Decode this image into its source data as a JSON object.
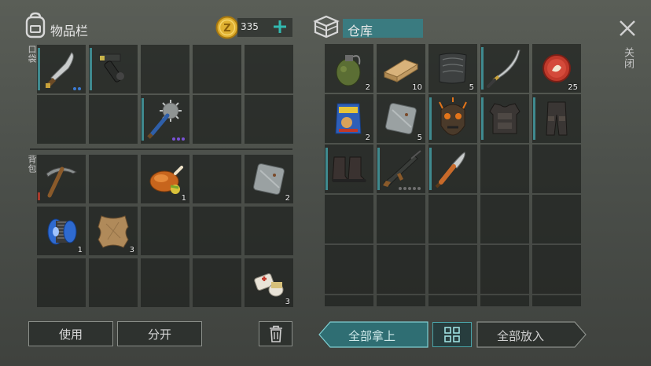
{
  "inventory": {
    "title": "物品栏",
    "coins": "335",
    "pocket_label": "口袋",
    "backpack_label": "背包",
    "use_button": "使用",
    "split_button": "分开",
    "items": [
      {
        "name": "machete-item",
        "icon": "machete-icon",
        "slot": [
          0,
          0
        ],
        "bar": "teal",
        "dots": [
          "#3b7bd4",
          "#3b7bd4"
        ]
      },
      {
        "name": "pistol-item",
        "icon": "pistol-icon",
        "slot": [
          1,
          0
        ],
        "bar": "teal"
      },
      {
        "name": "spiked-mace-item",
        "icon": "spiked-mace-icon",
        "slot": [
          2,
          1
        ],
        "bar": "teal",
        "dots": [
          "#7a52d6",
          "#7a52d6",
          "#7a52d6"
        ]
      },
      {
        "name": "pickaxe-item",
        "icon": "pickaxe-icon",
        "slot": [
          0,
          2
        ],
        "bar": "red"
      },
      {
        "name": "roast-chicken-item",
        "icon": "roast-chicken-icon",
        "slot": [
          2,
          2
        ],
        "count": "1"
      },
      {
        "name": "metal-plate-item",
        "icon": "metal-plate-icon",
        "slot": [
          4,
          2
        ],
        "count": "2"
      },
      {
        "name": "wire-spool-item",
        "icon": "wire-spool-icon",
        "slot": [
          0,
          3
        ],
        "count": "1"
      },
      {
        "name": "leather-item",
        "icon": "leather-icon",
        "slot": [
          1,
          3
        ],
        "count": "3"
      },
      {
        "name": "bandage-item",
        "icon": "bandage-icon",
        "slot": [
          4,
          4
        ],
        "count": "3"
      }
    ]
  },
  "storage": {
    "title": "仓库",
    "take_all_button": "全部拿上",
    "put_all_button": "全部放入",
    "items": [
      {
        "name": "grenade-item",
        "icon": "grenade-icon",
        "slot": [
          0,
          0
        ],
        "count": "2"
      },
      {
        "name": "wood-plank-item",
        "icon": "wood-plank-icon",
        "slot": [
          1,
          0
        ],
        "count": "10"
      },
      {
        "name": "tarp-item",
        "icon": "tarp-icon",
        "slot": [
          2,
          0
        ],
        "count": "5"
      },
      {
        "name": "katana-item",
        "icon": "katana-icon",
        "slot": [
          3,
          0
        ],
        "bar": "teal"
      },
      {
        "name": "bottle-cap-item",
        "icon": "bottle-cap-icon",
        "slot": [
          4,
          0
        ],
        "count": "25"
      },
      {
        "name": "dog-food-item",
        "icon": "dog-food-icon",
        "slot": [
          0,
          1
        ],
        "count": "2"
      },
      {
        "name": "metal-plate-item",
        "icon": "metal-plate-icon",
        "slot": [
          1,
          1
        ],
        "count": "5"
      },
      {
        "name": "skull-mask-item",
        "icon": "skull-mask-icon",
        "slot": [
          2,
          1
        ],
        "bar": "teal"
      },
      {
        "name": "body-armor-item",
        "icon": "body-armor-icon",
        "slot": [
          3,
          1
        ],
        "bar": "teal"
      },
      {
        "name": "armor-pants-item",
        "icon": "armor-pants-icon",
        "slot": [
          4,
          1
        ],
        "bar": "teal"
      },
      {
        "name": "boots-item",
        "icon": "boots-icon",
        "slot": [
          0,
          2
        ],
        "bar": "teal"
      },
      {
        "name": "assault-rifle-item",
        "icon": "assault-rifle-icon",
        "slot": [
          1,
          2
        ],
        "bar": "teal",
        "dots": [
          "#6e6e6e",
          "#6e6e6e",
          "#6e6e6e",
          "#6e6e6e",
          "#6e6e6e"
        ]
      },
      {
        "name": "knife-item",
        "icon": "knife-icon",
        "slot": [
          2,
          2
        ],
        "bar": "teal"
      }
    ]
  },
  "close_label": "关闭",
  "colors": {
    "accent": "#3f8a8f",
    "coin": "#e0b132",
    "plus": "#32b9b0"
  }
}
